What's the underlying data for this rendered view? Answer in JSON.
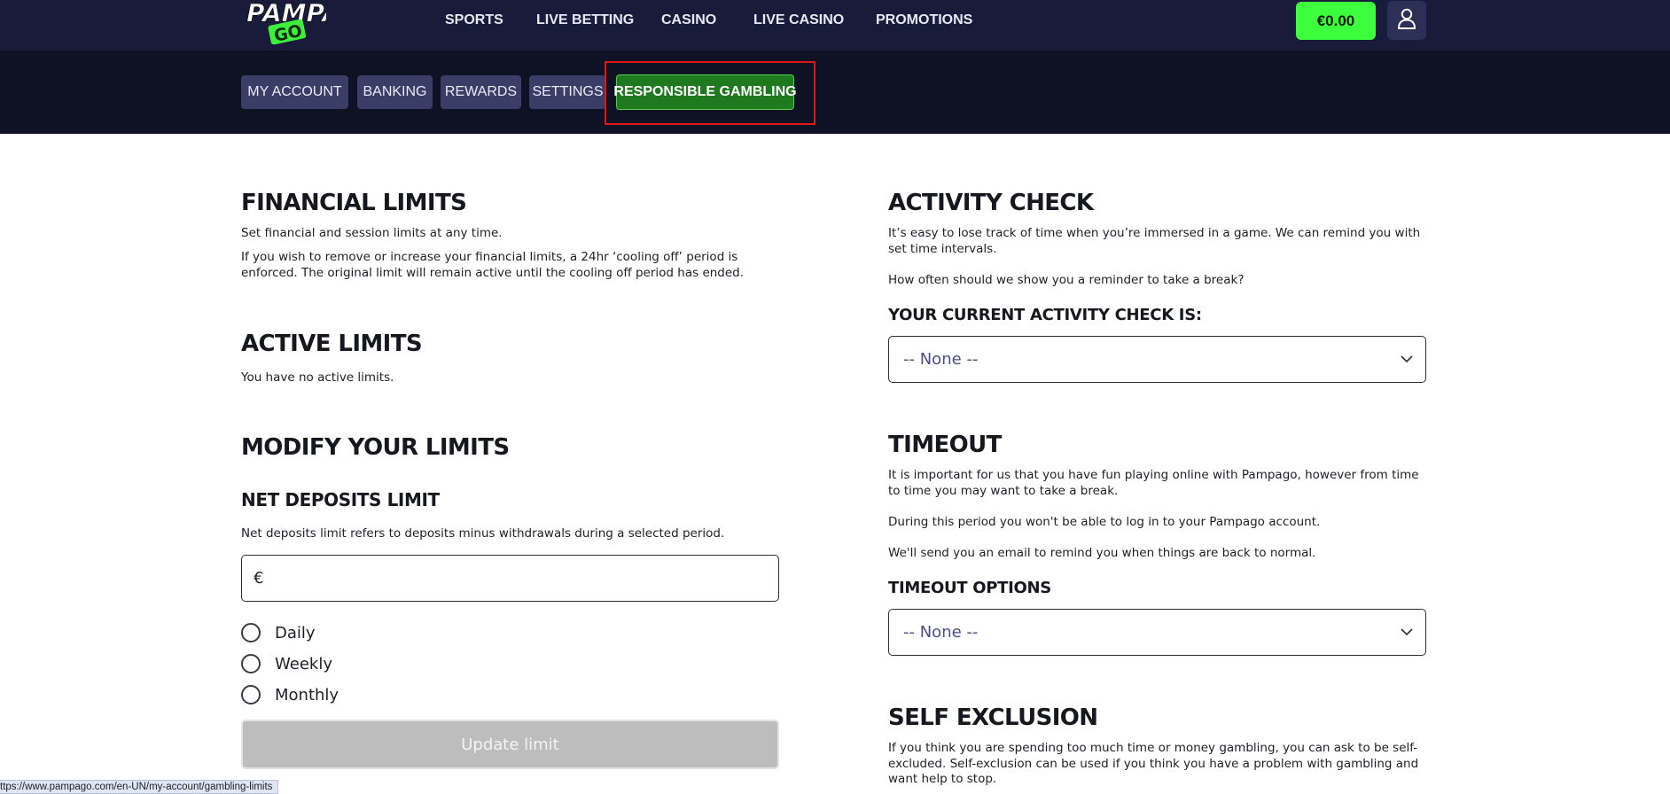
{
  "header": {
    "logo_text": "PAMPA GO",
    "nav": [
      "SPORTS",
      "LIVE BETTING",
      "CASINO",
      "LIVE CASINO",
      "PROMOTIONS"
    ],
    "balance": "€0.00",
    "user_icon": "user-icon"
  },
  "subnav": {
    "tabs": [
      "MY ACCOUNT",
      "BANKING",
      "REWARDS",
      "SETTINGS",
      "RESPONSIBLE GAMBLING"
    ],
    "active_tab": "RESPONSIBLE GAMBLING"
  },
  "left": {
    "financial_title": "FINANCIAL LIMITS",
    "financial_p1": "Set financial and session limits at any time.",
    "financial_p2": "If you wish to remove or increase your financial limits, a 24hr ‘cooling off’ period is enforced. The original limit will remain active until the cooling off period has ended.",
    "active_title": "ACTIVE LIMITS",
    "active_p": "You have no active limits.",
    "modify_title": "MODIFY YOUR LIMITS",
    "net_title": "NET DEPOSITS LIMIT",
    "net_p": "Net deposits limit refers to deposits minus withdrawals during a selected period.",
    "currency_symbol": "€",
    "input_value": "",
    "periods": [
      "Daily",
      "Weekly",
      "Monthly"
    ],
    "update_button": "Update limit"
  },
  "right": {
    "activity_title": "ACTIVITY CHECK",
    "activity_p1": "It’s easy to lose track of time when you’re immersed in a game. We can remind you with set time intervals.",
    "activity_p2": "How often should we show you a reminder to take a break?",
    "activity_current_label": "YOUR CURRENT ACTIVITY CHECK IS:",
    "activity_select": "-- None --",
    "timeout_title": "TIMEOUT",
    "timeout_p1": "It is important for us that you have fun playing online with Pampago, however from time to time you may want to take a break.",
    "timeout_p2": "During this period you won't be able to log in to your Pampago account.",
    "timeout_p3": "We'll send you an email to remind you when things are back to normal.",
    "timeout_options_label": "TIMEOUT OPTIONS",
    "timeout_select": "-- None --",
    "self_exclusion_title": "SELF EXCLUSION",
    "self_exclusion_p": "If you think you are spending too much time or money gambling, you can ask to be self-excluded. Self-exclusion can be used if you think you have a problem with gambling and want help to stop."
  },
  "status_bar_url": "ttps://www.pampago.com/en-UN/my-account/gambling-limits",
  "colors": {
    "header_bg": "#191b3b",
    "subnav_bg": "#0f1125",
    "balance_green": "#3dff3d",
    "active_tab_green": "#1f7a1f",
    "highlight_red": "#e01717"
  }
}
